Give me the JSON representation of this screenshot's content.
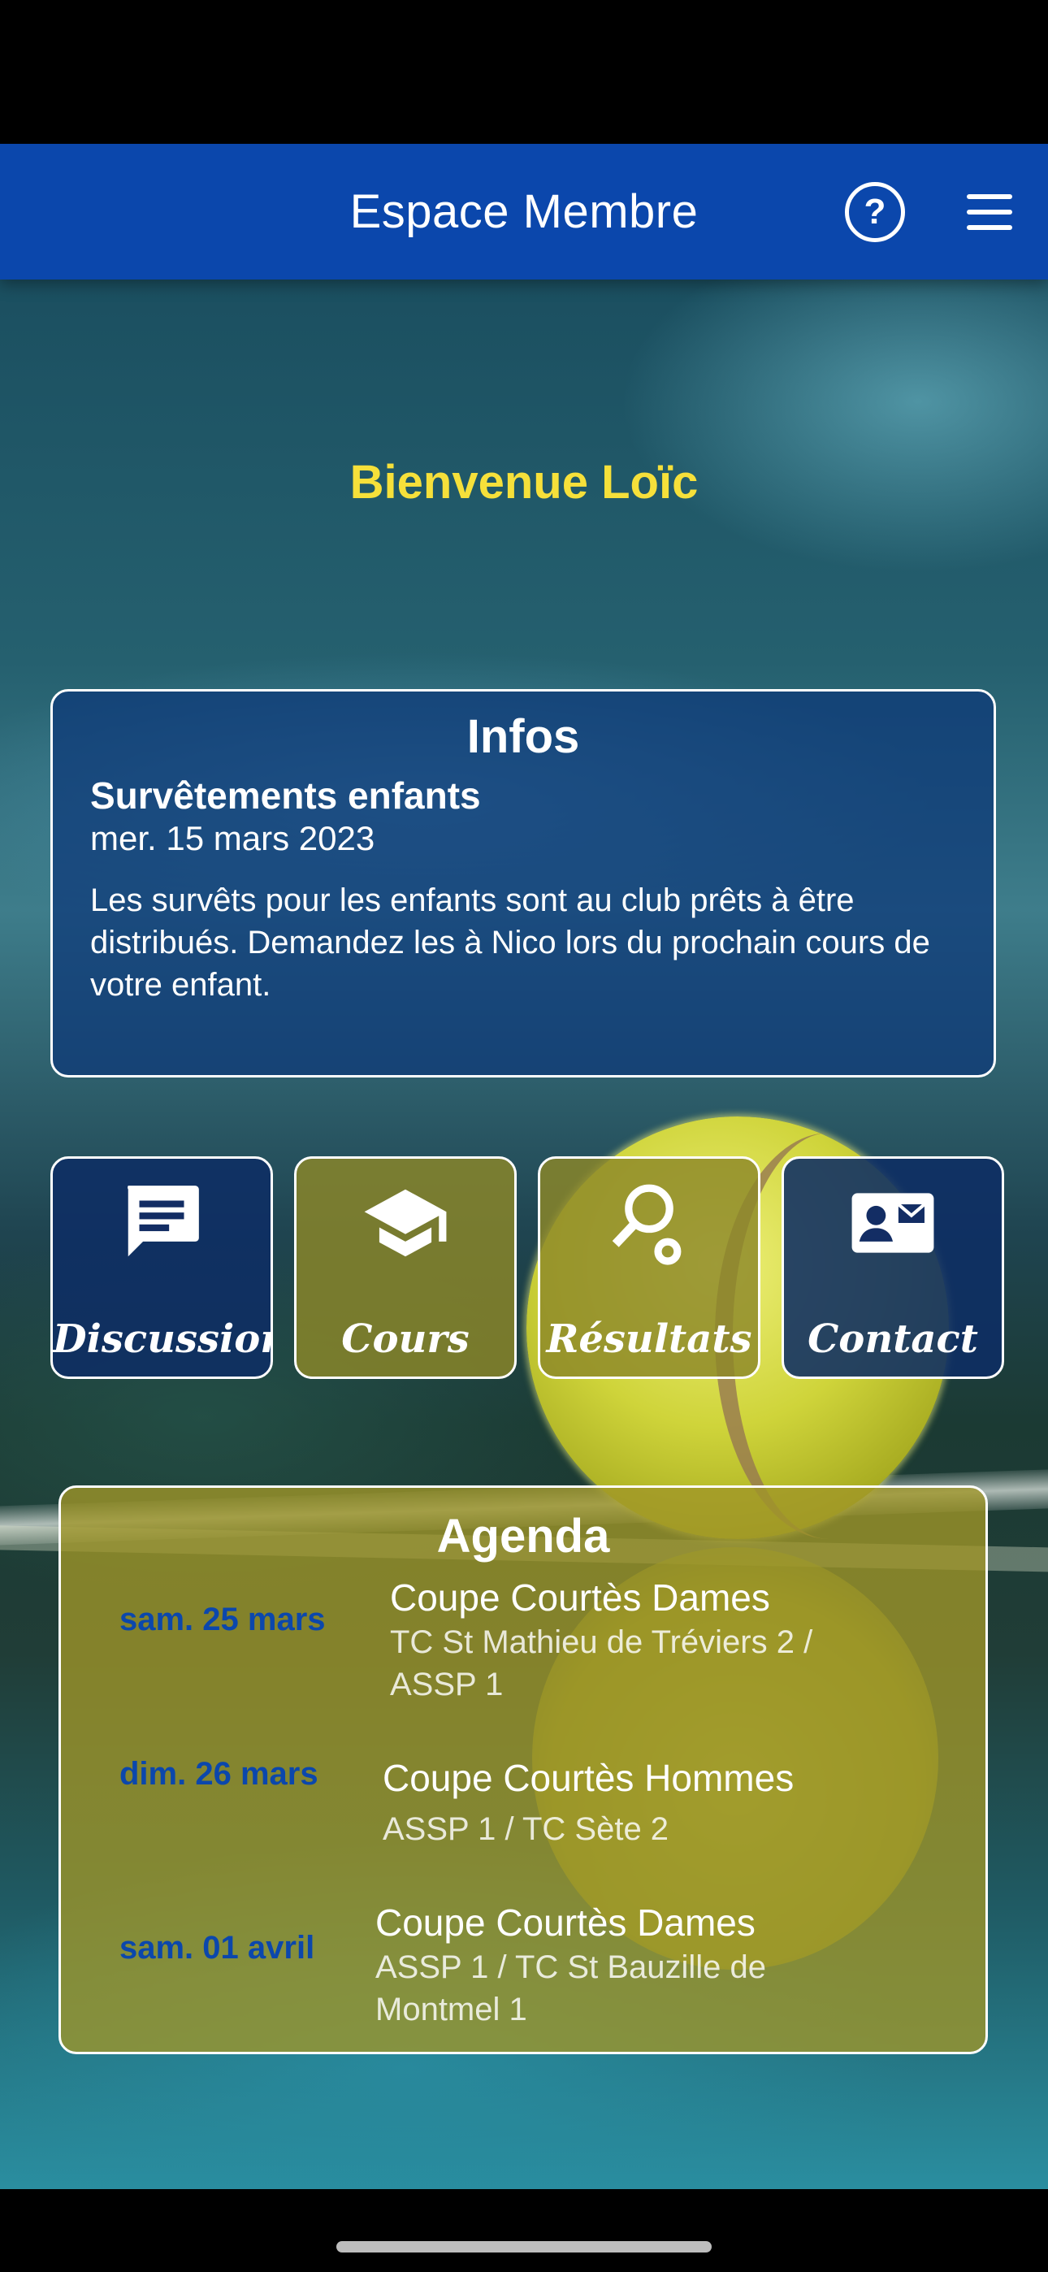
{
  "header": {
    "title": "Espace Membre",
    "help_icon": "help-circle-icon",
    "menu_icon": "hamburger-menu-icon",
    "help_glyph": "?"
  },
  "welcome": "Bienvenue Loïc",
  "infos": {
    "title": "Infos",
    "item": {
      "title": "Survêtements enfants",
      "date": "mer. 15 mars 2023",
      "body": "Les survêts pour les enfants sont au club  prêts à être distribués. Demandez les à Nico lors du prochain cours de votre enfant."
    }
  },
  "tiles": [
    {
      "label": "Discussions",
      "icon": "chat-icon"
    },
    {
      "label": "Cours",
      "icon": "graduation-cap-icon"
    },
    {
      "label": "Résultats",
      "icon": "tennis-racket-icon"
    },
    {
      "label": "Contact",
      "icon": "contact-card-icon"
    }
  ],
  "agenda": {
    "title": "Agenda",
    "events": [
      {
        "date": "sam. 25 mars",
        "title": "Coupe Courtès Dames",
        "detail": "TC St Mathieu de Tréviers 2 / ASSP 1"
      },
      {
        "date": "dim. 26 mars",
        "title": "Coupe Courtès Hommes",
        "detail": "ASSP 1 / TC Sète 2"
      },
      {
        "date": "sam. 01 avril",
        "title": "Coupe Courtès Dames",
        "detail": "ASSP 1 / TC St Bauzille de Montmel 1"
      }
    ]
  },
  "colors": {
    "header": "#0b47ac",
    "welcome": "#f6e03a",
    "agenda_date": "#0b47ac"
  }
}
